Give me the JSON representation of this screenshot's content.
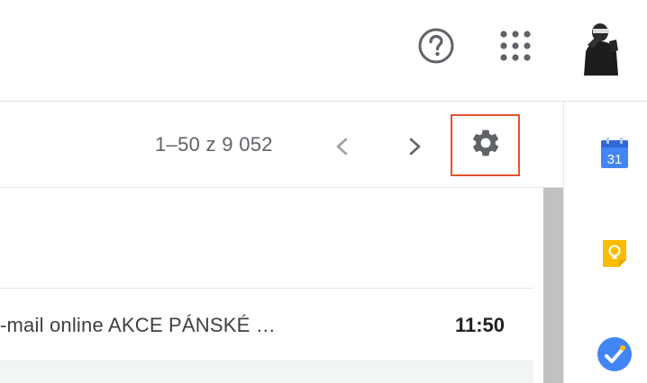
{
  "header": {
    "help_icon": "help-circle-icon",
    "apps_icon": "apps-grid-icon",
    "avatar_icon": "account-avatar"
  },
  "toolbar": {
    "page_count": "1–50 z 9 052",
    "prev_icon": "chevron-left-icon",
    "next_icon": "chevron-right-icon",
    "settings_icon": "gear-icon",
    "settings_highlight_color": "#e5522e"
  },
  "mail_list": {
    "rows": [
      {
        "snippet": "-mail online AKCE PÁNSKÉ …",
        "time": "11:50"
      }
    ]
  },
  "side_panel": {
    "calendar_day": "31",
    "icons": [
      "calendar-icon",
      "keep-icon",
      "tasks-icon"
    ]
  }
}
